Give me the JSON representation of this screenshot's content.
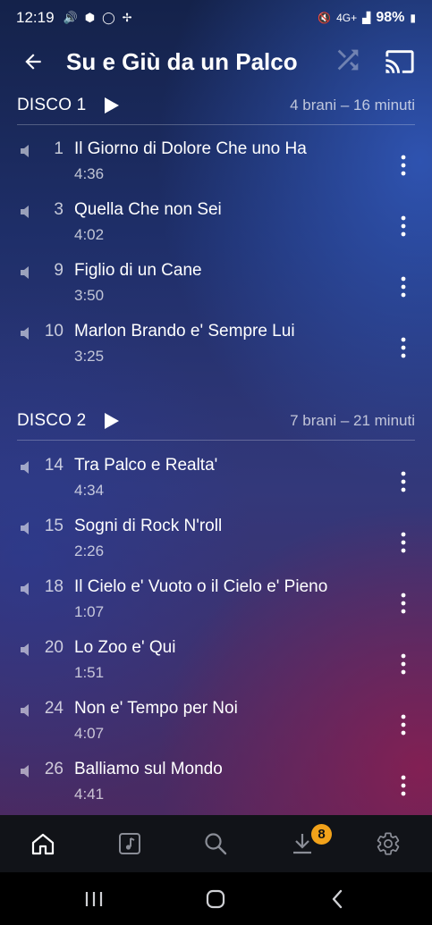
{
  "status": {
    "time": "12:19",
    "network": "4G+",
    "battery": "98%"
  },
  "header": {
    "title": "Su e Giù da un Palco"
  },
  "discs": [
    {
      "title": "DISCO 1",
      "info": "4 brani – 16 minuti",
      "tracks": [
        {
          "num": "1",
          "name": "Il Giorno di Dolore Che uno Ha",
          "dur": "4:36"
        },
        {
          "num": "3",
          "name": "Quella Che non Sei",
          "dur": "4:02"
        },
        {
          "num": "9",
          "name": "Figlio di un Cane",
          "dur": "3:50"
        },
        {
          "num": "10",
          "name": "Marlon Brando e' Sempre Lui",
          "dur": "3:25"
        }
      ]
    },
    {
      "title": "DISCO 2",
      "info": "7 brani – 21 minuti",
      "tracks": [
        {
          "num": "14",
          "name": "Tra Palco e Realta'",
          "dur": "4:34"
        },
        {
          "num": "15",
          "name": "Sogni di Rock N'roll",
          "dur": "2:26"
        },
        {
          "num": "18",
          "name": "Il Cielo e' Vuoto o il Cielo e' Pieno",
          "dur": "1:07"
        },
        {
          "num": "20",
          "name": "Lo Zoo e' Qui",
          "dur": "1:51"
        },
        {
          "num": "24",
          "name": "Non e' Tempo per Noi",
          "dur": "4:07"
        },
        {
          "num": "26",
          "name": "Balliamo sul Mondo",
          "dur": "4:41"
        }
      ]
    }
  ],
  "nav": {
    "items": [
      "home-icon",
      "music-note-icon",
      "search-icon",
      "download-icon",
      "settings-icon"
    ],
    "download_badge": "8",
    "accent": "#f2a21a"
  },
  "sysnav": [
    "recents-icon",
    "home-circle-icon",
    "back-chevron-icon"
  ]
}
